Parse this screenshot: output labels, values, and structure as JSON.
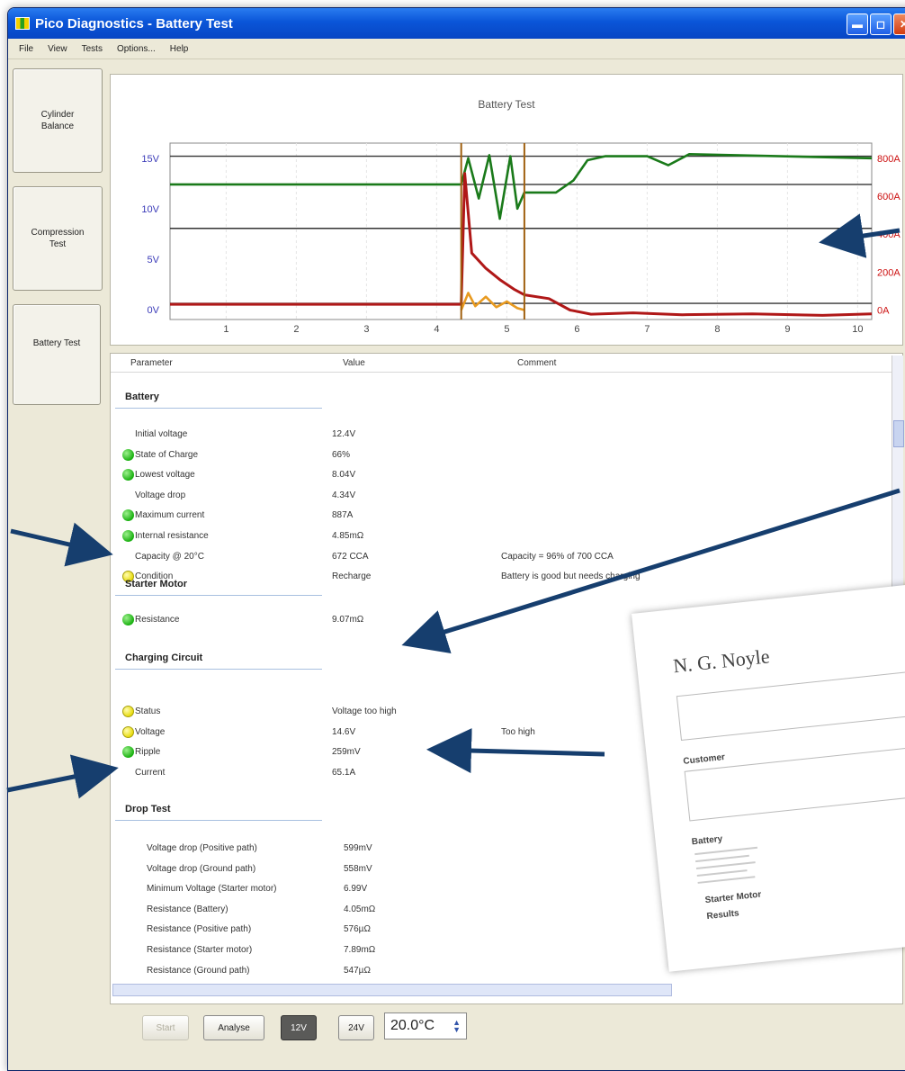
{
  "window": {
    "title": "Pico Diagnostics - Battery Test"
  },
  "menu": {
    "file": "File",
    "view": "View",
    "tests": "Tests",
    "options": "Options...",
    "help": "Help"
  },
  "sidebar": {
    "items": [
      {
        "label": "Cylinder\nBalance"
      },
      {
        "label": "Compression\nTest"
      },
      {
        "label": "Battery Test"
      }
    ]
  },
  "chart": {
    "title": "Battery Test"
  },
  "chart_data": {
    "type": "line",
    "title": "Battery Test",
    "x_ticks": [
      "1",
      "2",
      "3",
      "4",
      "5",
      "6",
      "7",
      "8",
      "9",
      "10"
    ],
    "xlim": [
      0.2,
      10.2
    ],
    "y_left_ticks": [
      "0V",
      "5V",
      "10V",
      "15V"
    ],
    "ylim_left": [
      -1,
      16.5
    ],
    "y_right_ticks": [
      "0A",
      "200A",
      "400A",
      "600A",
      "800A"
    ],
    "ylim_right": [
      -50,
      880
    ],
    "reference_lines_v": [
      12.4,
      8.04,
      0.6,
      15.2
    ],
    "markers_x": [
      4.35,
      5.25
    ],
    "series": [
      {
        "color": "#1a7a1a",
        "axis": "left",
        "points": [
          [
            0.2,
            12.4
          ],
          [
            4.35,
            12.4
          ],
          [
            4.45,
            15
          ],
          [
            4.6,
            11
          ],
          [
            4.75,
            15.3
          ],
          [
            4.9,
            9
          ],
          [
            5.05,
            15.2
          ],
          [
            5.15,
            10
          ],
          [
            5.25,
            11.6
          ],
          [
            5.7,
            11.6
          ],
          [
            5.95,
            12.8
          ],
          [
            6.15,
            14.8
          ],
          [
            6.4,
            15.2
          ],
          [
            7.0,
            15.2
          ],
          [
            7.3,
            14.3
          ],
          [
            7.6,
            15.4
          ],
          [
            10.2,
            15.0
          ]
        ]
      },
      {
        "color": "#b01818",
        "axis": "right",
        "points": [
          [
            0.2,
            30
          ],
          [
            4.35,
            30
          ],
          [
            4.4,
            720
          ],
          [
            4.5,
            300
          ],
          [
            4.7,
            220
          ],
          [
            4.9,
            160
          ],
          [
            5.1,
            110
          ],
          [
            5.25,
            80
          ],
          [
            5.6,
            60
          ],
          [
            5.9,
            0
          ],
          [
            6.2,
            -22
          ],
          [
            6.8,
            -15
          ],
          [
            7.5,
            -25
          ],
          [
            8.5,
            -20
          ],
          [
            9.5,
            -28
          ],
          [
            10.2,
            -20
          ]
        ]
      },
      {
        "color": "#e89a20",
        "axis": "right",
        "points": [
          [
            4.35,
            0
          ],
          [
            4.45,
            90
          ],
          [
            4.55,
            20
          ],
          [
            4.7,
            70
          ],
          [
            4.85,
            15
          ],
          [
            5.0,
            45
          ],
          [
            5.15,
            10
          ],
          [
            5.25,
            0
          ]
        ]
      }
    ]
  },
  "results": {
    "headers": {
      "parameter": "Parameter",
      "value": "Value",
      "comment": "Comment"
    },
    "sections": {
      "battery": "Battery",
      "starter": "Starter Motor",
      "charging": "Charging Circuit",
      "drop": "Drop Test"
    },
    "battery": [
      {
        "name": "Initial voltage",
        "value": "12.4V",
        "comment": ""
      },
      {
        "name": "State of Charge",
        "value": "66%",
        "comment": ""
      },
      {
        "name": "Lowest voltage",
        "value": "8.04V",
        "comment": ""
      },
      {
        "name": "Voltage drop",
        "value": "4.34V",
        "comment": ""
      },
      {
        "name": "Maximum current",
        "value": "887A",
        "comment": ""
      },
      {
        "name": "Internal resistance",
        "value": "4.85mΩ",
        "comment": ""
      },
      {
        "name": "Capacity @ 20°C",
        "value": "672 CCA",
        "comment": "Capacity = 96% of 700 CCA"
      },
      {
        "name": "Condition",
        "value": "Recharge",
        "comment": "Battery is good but needs charging"
      }
    ],
    "starter": [
      {
        "name": "Resistance",
        "value": "9.07mΩ",
        "comment": ""
      }
    ],
    "charging": [
      {
        "name": "Status",
        "value": "Voltage too high",
        "comment": ""
      },
      {
        "name": "Voltage",
        "value": "14.6V",
        "comment": "Too high"
      },
      {
        "name": "Ripple",
        "value": "259mV",
        "comment": ""
      },
      {
        "name": "Current",
        "value": "65.1A",
        "comment": ""
      }
    ],
    "drop": [
      {
        "name": "Voltage drop (Positive path)",
        "value": "599mV"
      },
      {
        "name": "Voltage drop (Ground path)",
        "value": "558mV"
      },
      {
        "name": "Minimum Voltage (Starter motor)",
        "value": "6.99V"
      },
      {
        "name": "Resistance (Battery)",
        "value": "4.05mΩ"
      },
      {
        "name": "Resistance (Positive path)",
        "value": "576µΩ"
      },
      {
        "name": "Resistance (Starter motor)",
        "value": "7.89mΩ"
      },
      {
        "name": "Resistance (Ground path)",
        "value": "547µΩ"
      }
    ]
  },
  "toolbar": {
    "start": "Start",
    "analyse": "Analyse",
    "v12": "12V",
    "v24": "24V",
    "temperature": "20.0°C"
  },
  "report": {
    "title": "N. G. Noyle",
    "customer": "Customer",
    "battery": "Battery",
    "starter": "Starter Motor",
    "results": "Results"
  },
  "colors": {
    "title_bar": "#0a55d8",
    "voltage_trace": "#1a7a1a",
    "current_trace": "#b01818",
    "right_axis_text": "#cc1010",
    "left_axis_text": "#3b3bb8",
    "status_ok": "#19b010",
    "status_warn": "#e8dc10",
    "arrow": "#163e6e"
  }
}
